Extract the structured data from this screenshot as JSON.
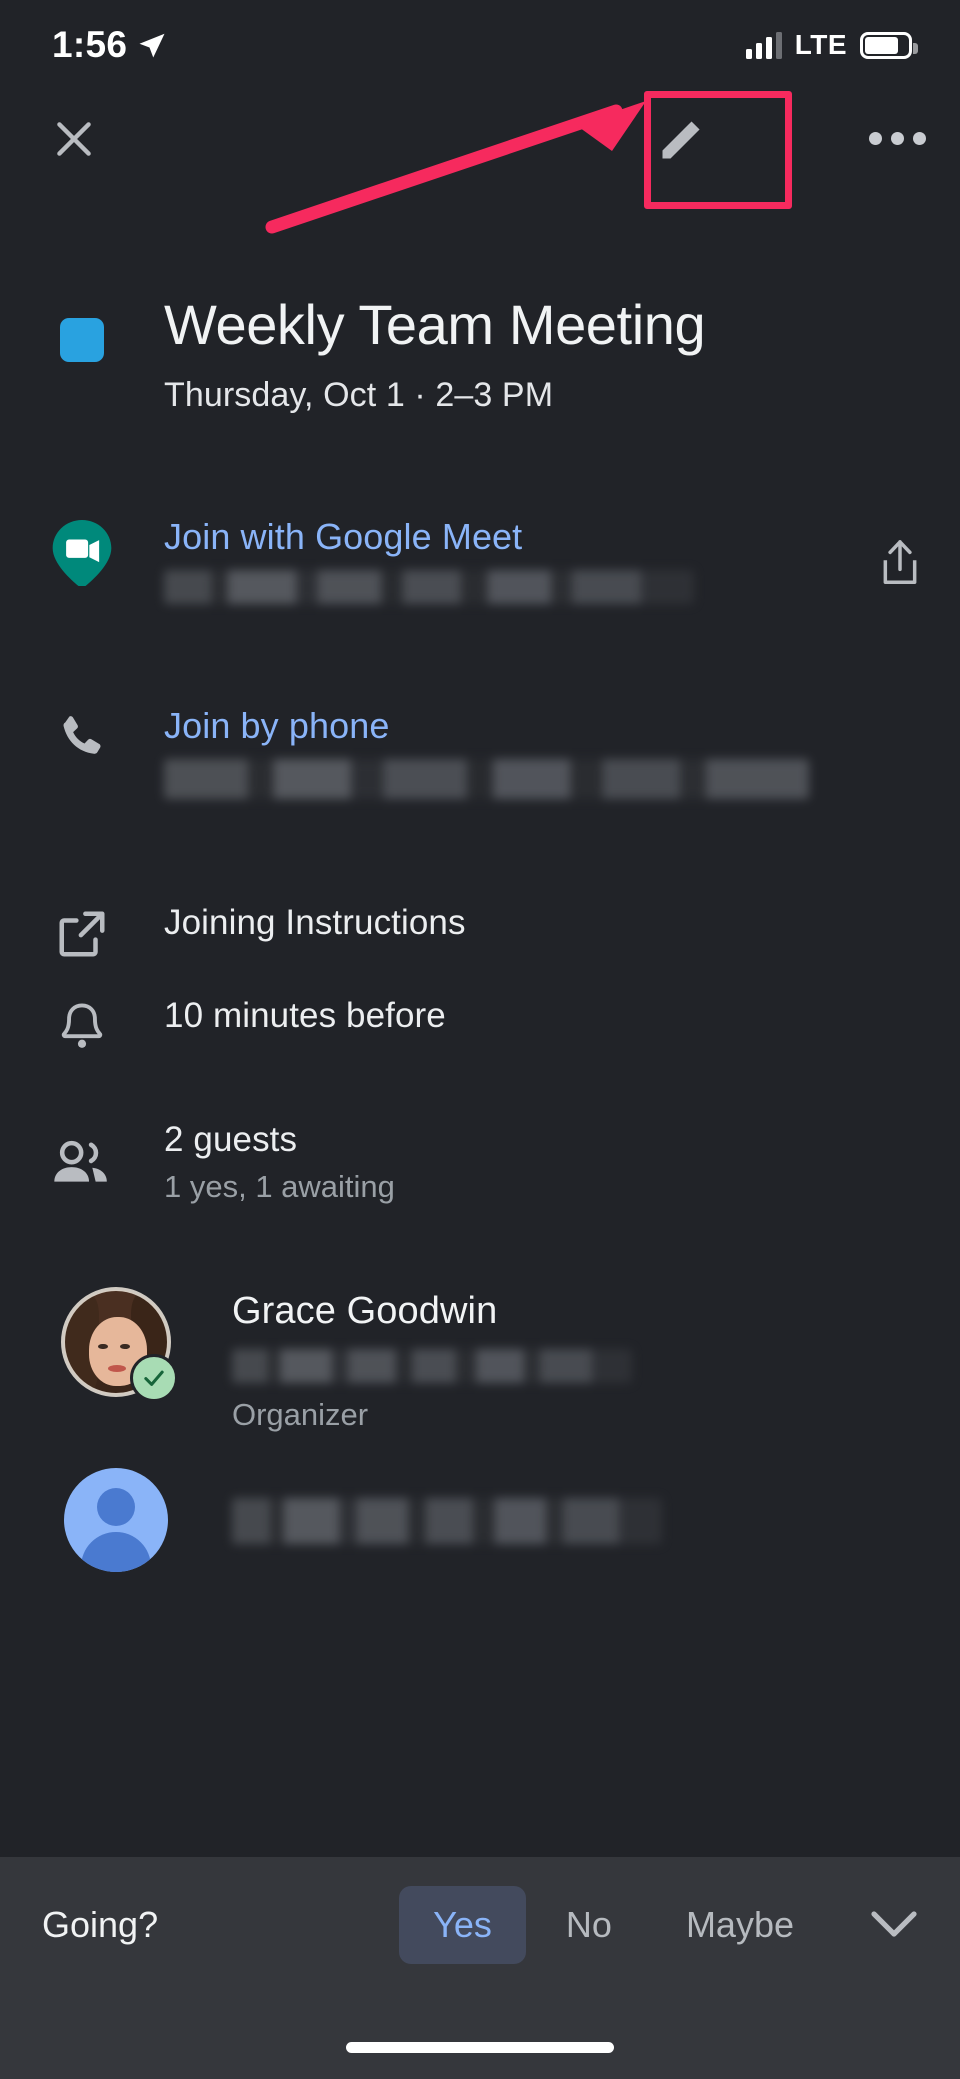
{
  "status_bar": {
    "time": "1:56",
    "location_icon": "location-arrow-icon",
    "network": "LTE",
    "signal_icon": "cellular-signal-icon",
    "battery_icon": "battery-icon"
  },
  "top_bar": {
    "close_label": "✕",
    "close_icon": "close-icon",
    "edit_icon": "pencil-edit-icon",
    "more_icon": "more-options-icon"
  },
  "annotation": {
    "color": "#f62a5e",
    "highlight_target": "edit-button",
    "shape": "rectangle-with-arrow"
  },
  "event": {
    "color_chip": "#29a2e0",
    "title": "Weekly Team Meeting",
    "when": "Thursday, Oct 1 · 2–3 PM"
  },
  "details": [
    {
      "name": "google-meet",
      "icon": "google-meet-icon",
      "label": "Join with Google Meet",
      "link": true,
      "redacted": true,
      "trailing_icon": "share-icon"
    },
    {
      "name": "join-by-phone",
      "icon": "phone-icon",
      "label": "Join by phone",
      "link": true,
      "redacted": true
    },
    {
      "name": "joining-instructions",
      "icon": "external-link-icon",
      "label": "Joining Instructions",
      "link": false,
      "redacted": false
    },
    {
      "name": "notification",
      "icon": "bell-icon",
      "label": "10 minutes before",
      "link": false,
      "redacted": false
    }
  ],
  "guests": {
    "icon": "people-icon",
    "count_label": "2 guests",
    "status_label": "1 yes, 1 awaiting",
    "list": [
      {
        "name": "Grace Goodwin",
        "role": "Organizer",
        "avatar": "photo-avatar",
        "rsvp_badge": "accepted-check-icon",
        "email_redacted": true
      },
      {
        "name": "",
        "role": "",
        "avatar": "default-person-avatar",
        "rsvp_badge": "",
        "email_redacted": true
      }
    ]
  },
  "rsvp_bar": {
    "prompt": "Going?",
    "options": [
      "Yes",
      "No",
      "Maybe"
    ],
    "selected": "Yes",
    "expand_icon": "chevron-down-icon",
    "selected_color": "#8ab4f8",
    "selected_bg": "#434a5d"
  }
}
